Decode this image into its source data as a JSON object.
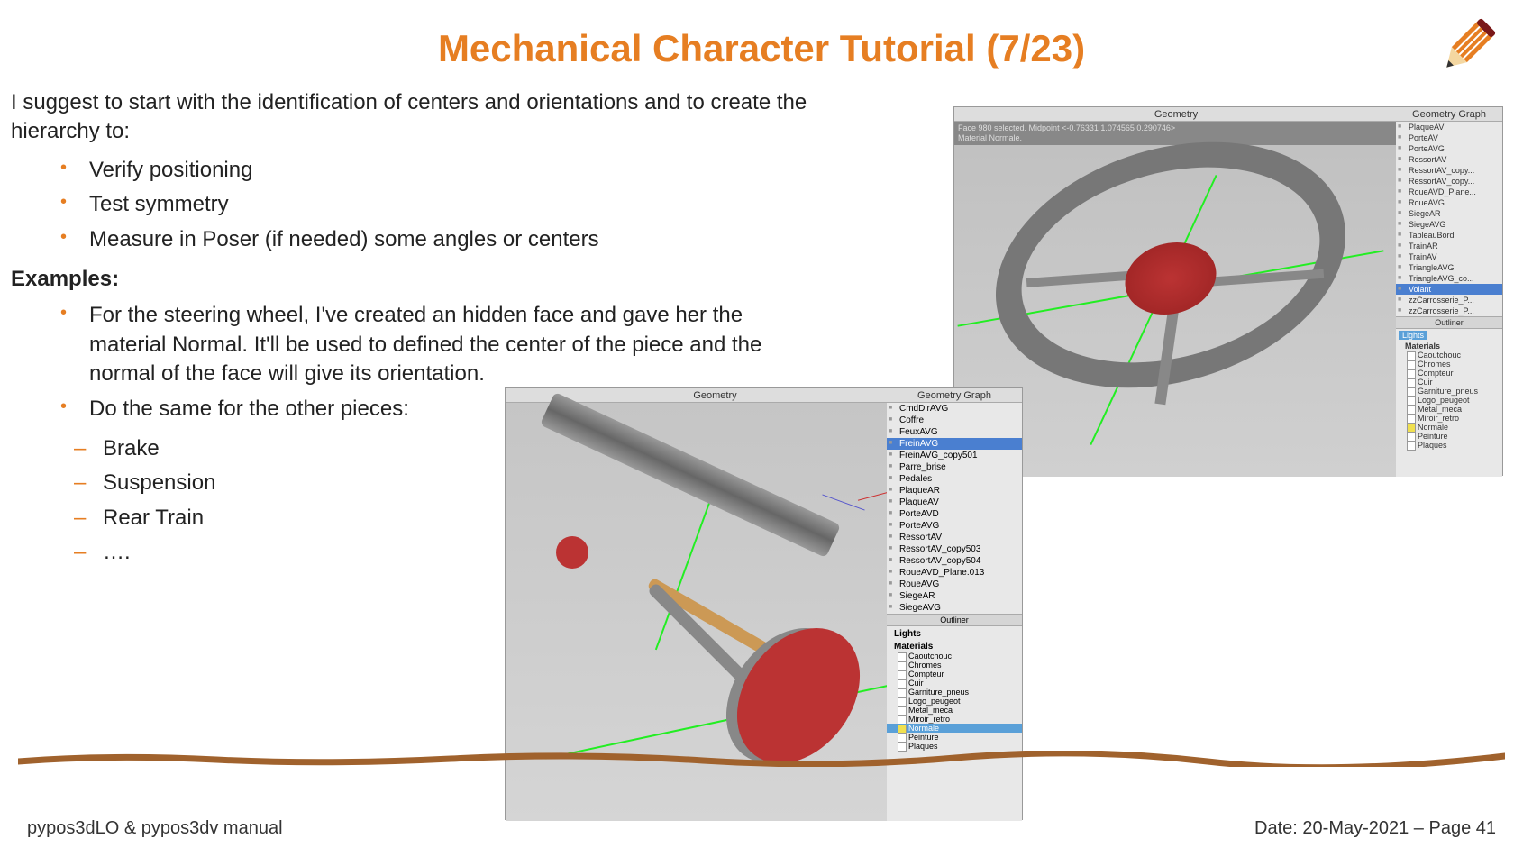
{
  "title": "Mechanical Character Tutorial (7/23)",
  "intro": "I suggest to start with the identification of centers and orientations and to create the hierarchy to:",
  "bullets": [
    "Verify positioning",
    "Test symmetry",
    "Measure in Poser (if needed) some angles or centers"
  ],
  "examples_heading": "Examples:",
  "example_bullets": [
    "For the steering wheel, I've created an hidden face and gave her the material Normal. It'll be used to defined the center of the piece and the normal of the face will give its orientation.",
    "Do the same for the other pieces:"
  ],
  "sub_items": [
    "Brake",
    "Suspension",
    "Rear Train",
    "…."
  ],
  "panel_top": {
    "geometry_label": "Geometry",
    "graph_label": "Geometry Graph",
    "info_line1": "Face 980 selected. Midpoint <-0.76331  1.074565  0.290746>",
    "info_line2": "Material Normale.",
    "objects": [
      "PlaqueAV",
      "PorteAV",
      "PorteAVG",
      "RessortAV",
      "RessortAV_copy...",
      "RessortAV_copy...",
      "RoueAVD_Plane...",
      "RoueAVG",
      "SiegeAR",
      "SiegeAVG",
      "TableauBord",
      "TrainAR",
      "TrainAV",
      "TriangleAVG",
      "TriangleAVG_co..."
    ],
    "selected_object": "Volant",
    "objects_after": [
      "zzCarrosserie_P...",
      "zzCarrosserie_P..."
    ],
    "outliner_label": "Outliner",
    "lights_label": "Lights",
    "materials_label": "Materials",
    "materials": [
      "Caoutchouc",
      "Chromes",
      "Compteur",
      "Cuir",
      "Garniture_pneus",
      "Logo_peugeot",
      "Metal_meca",
      "Miroir_retro",
      "Normale",
      "Peinture",
      "Plaques"
    ]
  },
  "panel_bottom": {
    "geometry_label": "Geometry",
    "graph_label": "Geometry Graph",
    "objects": [
      "CmdDirAVG",
      "Coffre",
      "FeuxAVG"
    ],
    "selected_object": "FreinAVG",
    "objects_after": [
      "FreinAVG_copy501",
      "Parre_brise",
      "Pedales",
      "PlaqueAR",
      "PlaqueAV",
      "PorteAVD",
      "PorteAVG",
      "RessortAV",
      "RessortAV_copy503",
      "RessortAV_copy504",
      "RoueAVD_Plane.013",
      "RoueAVG",
      "SiegeAR",
      "SiegeAVG"
    ],
    "outliner_label": "Outliner",
    "lights_label": "Lights",
    "materials_label": "Materials",
    "materials": [
      "Caoutchouc",
      "Chromes",
      "Compteur",
      "Cuir",
      "Garniture_pneus",
      "Logo_peugeot",
      "Metal_meca",
      "Miroir_retro"
    ],
    "material_highlight": "Normale",
    "materials_after": [
      "Peinture",
      "Plaques"
    ]
  },
  "footer_left": "pypos3dLO & pypos3dv manual",
  "footer_right": "Date: 20-May-2021 – Page 41"
}
